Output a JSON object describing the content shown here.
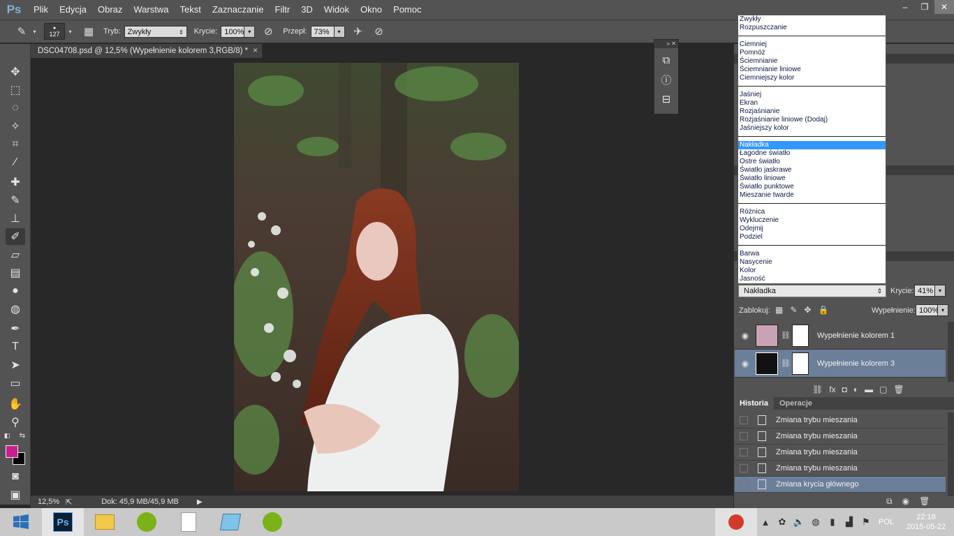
{
  "app": {
    "logo": "Ps"
  },
  "menu": [
    "Plik",
    "Edycja",
    "Obraz",
    "Warstwa",
    "Tekst",
    "Zaznaczanie",
    "Filtr",
    "3D",
    "Widok",
    "Okno",
    "Pomoc"
  ],
  "window_controls": [
    "–",
    "❐",
    "✕"
  ],
  "options": {
    "brush_size": "127",
    "mode_label": "Tryb:",
    "mode_value": "Zwykły",
    "opacity_label": "Krycie:",
    "opacity_value": "100%",
    "flow_label": "Przepł:",
    "flow_value": "73%"
  },
  "document": {
    "tab_title": "DSC04708.psd @ 12,5% (Wypełnienie kolorem 3,RGB/8) *",
    "tab_close": "×"
  },
  "status": {
    "zoom": "12,5%",
    "doc_info": "Dok: 45,9 MB/45,9 MB"
  },
  "blend_modes": [
    [
      "Zwykły",
      "Rozpuszczanie"
    ],
    [
      "Ciemniej",
      "Pomnóż",
      "Ściemnianie",
      "Ściemnianie liniowe",
      "Ciemniejszy kolor"
    ],
    [
      "Jaśniej",
      "Ekran",
      "Rozjaśnianie",
      "Rozjaśnianie liniowe (Dodaj)",
      "Jaśniejszy kolor"
    ],
    [
      "Nakładka",
      "Łagodne światło",
      "Ostre światło",
      "Światło jaskrawe",
      "Światło liniowe",
      "Światło punktowe",
      "Mieszanie twarde"
    ],
    [
      "Różnica",
      "Wykluczenie",
      "Odejmij",
      "Podziel"
    ],
    [
      "Barwa",
      "Nasycenie",
      "Kolor",
      "Jasność"
    ]
  ],
  "layers_panel": {
    "blend_value": "Nakładka",
    "opacity_label": "Krycie:",
    "opacity_value": "41%",
    "lock_label": "Zablokuj:",
    "fill_label": "Wypełnienie:",
    "fill_value": "100%",
    "layers": [
      {
        "name": "Wypełnienie kolorem 1",
        "color": "#c9a3b5",
        "selected": false
      },
      {
        "name": "Wypełnienie kolorem 3",
        "color": "#111111",
        "selected": true
      }
    ]
  },
  "history_panel": {
    "tabs": [
      "Historia",
      "Operacje"
    ],
    "items": [
      "Zmiana trybu mieszania",
      "Zmiana trybu mieszania",
      "Zmiana trybu mieszania",
      "Zmiana trybu mieszania",
      "Zmiana krycia głównego"
    ]
  },
  "taskbar": {
    "lang": "POL",
    "time": "22:18",
    "date": "2015-05-22"
  },
  "colors": {
    "foreground": "#c81f8f",
    "background": "#000000",
    "accent": "#3399ff"
  }
}
